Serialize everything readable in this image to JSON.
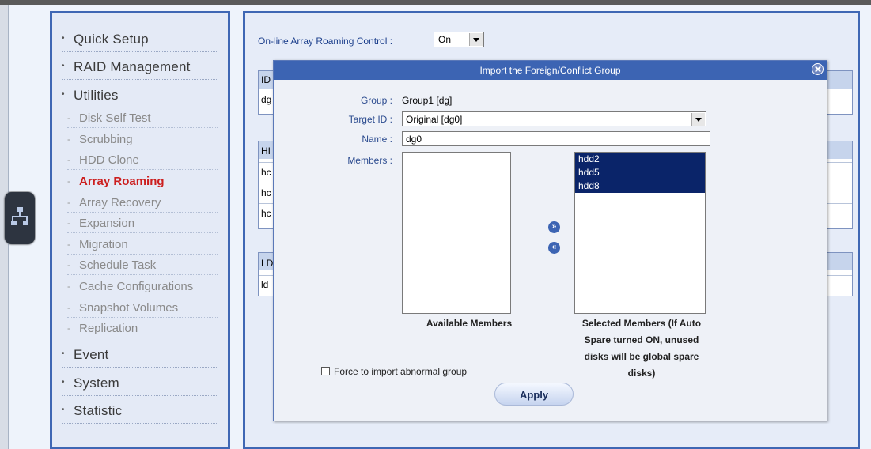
{
  "sidebar": {
    "groups": [
      {
        "label": "Quick Setup"
      },
      {
        "label": "RAID Management"
      },
      {
        "label": "Utilities"
      },
      {
        "label": "Event"
      },
      {
        "label": "System"
      },
      {
        "label": "Statistic"
      }
    ],
    "utilities_items": [
      {
        "label": "Disk Self Test"
      },
      {
        "label": "Scrubbing"
      },
      {
        "label": "HDD Clone"
      },
      {
        "label": "Array Roaming",
        "active": true
      },
      {
        "label": "Array Recovery"
      },
      {
        "label": "Expansion"
      },
      {
        "label": "Migration"
      },
      {
        "label": "Schedule Task"
      },
      {
        "label": "Cache Configurations"
      },
      {
        "label": "Snapshot Volumes"
      },
      {
        "label": "Replication"
      }
    ]
  },
  "main": {
    "roaming_label": "On-line Array Roaming Control :",
    "roaming_value": "On",
    "bg_table1": {
      "header": "ID",
      "rows": [
        "dg"
      ]
    },
    "bg_table2": {
      "header": "HI",
      "rows": [
        "hc",
        "hc",
        "hc"
      ]
    },
    "bg_table3": {
      "header": "LD",
      "rows": [
        "ld"
      ]
    }
  },
  "modal": {
    "title": "Import the Foreign/Conflict Group",
    "group_label": "Group :",
    "group_value": "Group1 [dg]",
    "target_label": "Target ID :",
    "target_value": "Original [dg0]",
    "name_label": "Name :",
    "name_value": "dg0",
    "members_label": "Members :",
    "available_members": [],
    "selected_members": [
      "hdd2",
      "hdd5",
      "hdd8"
    ],
    "available_caption": "Available Members",
    "selected_caption_lines": [
      "Selected Members (If Auto",
      "Spare turned ON, unused",
      "disks will be global spare",
      "disks)"
    ],
    "force_label": "Force to import abnormal group",
    "force_checked": false,
    "apply_label": "Apply"
  }
}
